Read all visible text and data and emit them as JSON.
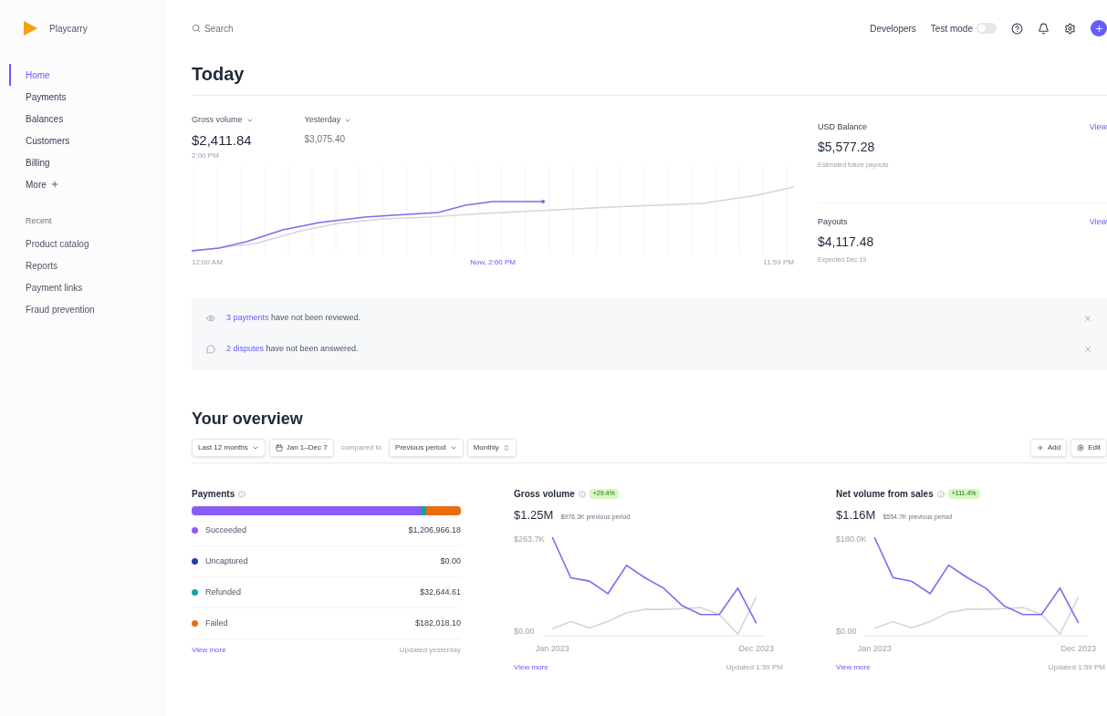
{
  "brand": {
    "name": "Playcarry"
  },
  "search": {
    "placeholder": "Search"
  },
  "topbar": {
    "developers": "Developers",
    "test_mode": {
      "label": "Test mode",
      "on": false
    }
  },
  "sidebar": {
    "items": [
      {
        "label": "Home",
        "selected": true,
        "kind": "link"
      },
      {
        "label": "Payments",
        "selected": false,
        "kind": "link"
      },
      {
        "label": "Balances",
        "selected": false,
        "kind": "link"
      },
      {
        "label": "Customers",
        "selected": false,
        "kind": "link"
      },
      {
        "label": "Billing",
        "selected": false,
        "kind": "link"
      },
      {
        "label": "More",
        "selected": false,
        "kind": "more"
      }
    ],
    "recent_title": "Recent",
    "recent": [
      {
        "label": "Product catalog"
      },
      {
        "label": "Reports"
      },
      {
        "label": "Payment links"
      },
      {
        "label": "Fraud prevention"
      }
    ]
  },
  "today": {
    "title": "Today",
    "gross": {
      "label": "Gross volume",
      "value": "$2,411.84",
      "time": "2:00 PM"
    },
    "yesterday": {
      "label": "Yesterday",
      "value": "$3,075.40"
    },
    "axis_labels": [
      "12:00 AM",
      "Now, 2:00 PM",
      "11:59 PM"
    ],
    "balance": {
      "label": "USD Balance",
      "value": "$5,577.28",
      "note": "Estimated future payouts",
      "link": "View"
    },
    "payouts": {
      "label": "Payouts",
      "value": "$4,117.48",
      "note": "Expected Dec 19",
      "link": "View"
    }
  },
  "alerts": [
    {
      "kind": "review",
      "link": "3 payments",
      "text": "have not been reviewed."
    },
    {
      "kind": "dispute",
      "link": "2 disputes",
      "text": "have not been answered."
    }
  ],
  "overview": {
    "title": "Your overview",
    "filters": [
      {
        "kind": "range",
        "label": "Last 12 months"
      },
      {
        "kind": "date",
        "label": "Jan 1–Dec 7"
      },
      {
        "kind": "text",
        "label": "compared to"
      },
      {
        "kind": "range",
        "label": "Previous period"
      },
      {
        "kind": "interval",
        "label": "Monthly"
      }
    ],
    "actions": [
      {
        "kind": "add",
        "label": "Add"
      },
      {
        "kind": "edit",
        "label": "Edit"
      }
    ],
    "payments": {
      "title": "Payments",
      "statuses": [
        {
          "label": "Succeeded",
          "value": "$1,206,966.18",
          "color": "#8b5cf6",
          "level": 0.85
        },
        {
          "label": "Uncaptured",
          "value": "$0.00",
          "color": "#1e40af",
          "level": 0.0
        },
        {
          "label": "Refunded",
          "value": "$32,644.61",
          "color": "#14a3a3",
          "level": 0.02
        },
        {
          "label": "Failed",
          "value": "$182,018.10",
          "color": "#ea6c0c",
          "level": 0.13
        }
      ],
      "link": "View more",
      "updated": "Updated yesterday"
    },
    "cards": [
      {
        "title": "Gross volume",
        "badge": "+29.4%",
        "value": "$1.25M",
        "previous": "$976.3K previous period",
        "link": "View more",
        "updated": "Updated 1:59 PM",
        "chart_data": {
          "type": "line",
          "categories": [
            "Jan 2023",
            null,
            null,
            null,
            null,
            null,
            null,
            null,
            null,
            null,
            null,
            "Dec 2023"
          ],
          "ylim": [
            0,
            263.7
          ],
          "yticks": [
            {
              "value": 0,
              "label": "$0.00"
            },
            {
              "value": 263.7,
              "label": "$263.7K"
            }
          ],
          "series": [
            {
              "color": "#7c6cf0",
              "values": [
                263.7,
                153,
                144,
                110,
                187,
                153,
                125,
                77,
                53,
                53,
                125,
                29
              ]
            },
            {
              "color": "#d1d5db",
              "values": [
                14,
                34,
                16,
                34,
                58,
                67,
                67,
                69,
                72,
                53,
                0,
                101
              ]
            }
          ]
        }
      },
      {
        "title": "Net volume from sales",
        "badge": "+111.4%",
        "value": "$1.16M",
        "previous": "$554.7K previous period",
        "link": "View more",
        "updated": "Updated 1:59 PM",
        "chart_data": {
          "type": "line",
          "categories": [
            "Jan 2023",
            null,
            null,
            null,
            null,
            null,
            null,
            null,
            null,
            null,
            null,
            "Dec 2023"
          ],
          "ylim": [
            0,
            180
          ],
          "yticks": [
            {
              "value": 0,
              "label": "$0.00"
            },
            {
              "value": 180,
              "label": "$180.0K"
            }
          ],
          "series": [
            {
              "color": "#7c6cf0",
              "values": [
                180,
                105,
                98,
                75,
                128,
                105,
                85,
                52,
                36,
                36,
                85,
                20
              ]
            },
            {
              "color": "#d1d5db",
              "values": [
                10,
                23,
                11,
                23,
                40,
                46,
                46,
                47,
                49,
                36,
                0,
                69
              ]
            }
          ]
        }
      }
    ]
  }
}
